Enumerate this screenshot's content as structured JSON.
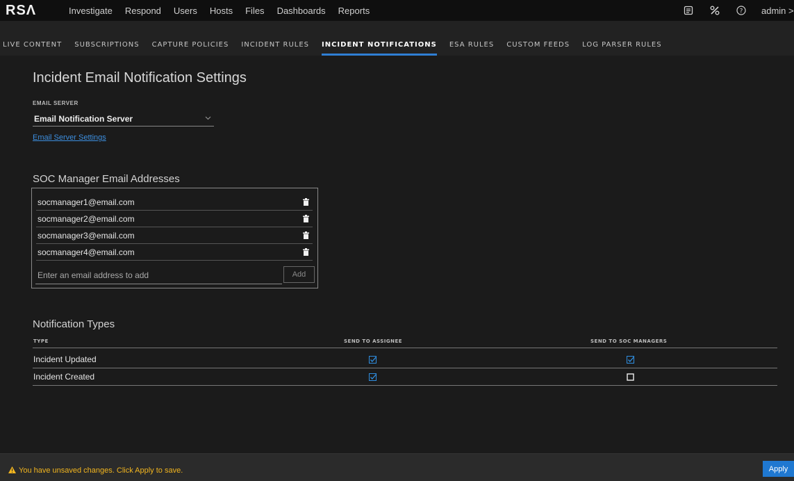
{
  "app": {
    "logo": "RSΛ"
  },
  "top_nav": {
    "items": [
      "Investigate",
      "Respond",
      "Users",
      "Hosts",
      "Files",
      "Dashboards",
      "Reports"
    ],
    "icons": [
      "notes-icon",
      "tools-icon",
      "help-icon"
    ],
    "user": "admin >"
  },
  "tabs": [
    {
      "label": "LIVE CONTENT",
      "active": false
    },
    {
      "label": "SUBSCRIPTIONS",
      "active": false
    },
    {
      "label": "CAPTURE POLICIES",
      "active": false
    },
    {
      "label": "INCIDENT RULES",
      "active": false
    },
    {
      "label": "INCIDENT NOTIFICATIONS",
      "active": true
    },
    {
      "label": "ESA RULES",
      "active": false
    },
    {
      "label": "CUSTOM FEEDS",
      "active": false
    },
    {
      "label": "LOG PARSER RULES",
      "active": false
    }
  ],
  "page": {
    "title": "Incident Email Notification Settings",
    "email_server_label": "EMAIL SERVER",
    "email_server_value": "Email Notification Server",
    "email_server_settings_link": "Email Server Settings"
  },
  "soc": {
    "title": "SOC Manager Email Addresses",
    "emails": [
      "socmanager1@email.com",
      "socmanager2@email.com",
      "socmanager3@email.com",
      "socmanager4@email.com"
    ],
    "input_placeholder": "Enter an email address to add",
    "add_label": "Add"
  },
  "notifications": {
    "title": "Notification Types",
    "headers": {
      "type": "TYPE",
      "assignee": "SEND TO ASSIGNEE",
      "managers": "SEND TO SOC MANAGERS"
    },
    "rows": [
      {
        "type": "Incident Updated",
        "send_to_assignee": true,
        "send_to_soc_managers": true
      },
      {
        "type": "Incident Created",
        "send_to_assignee": true,
        "send_to_soc_managers": false
      }
    ]
  },
  "bottom": {
    "warning": "You have unsaved changes. Click Apply to save.",
    "apply_label": "Apply"
  },
  "colors": {
    "accent": "#1f78d1",
    "warning": "#f2b51f",
    "link": "#3d8fe0"
  }
}
